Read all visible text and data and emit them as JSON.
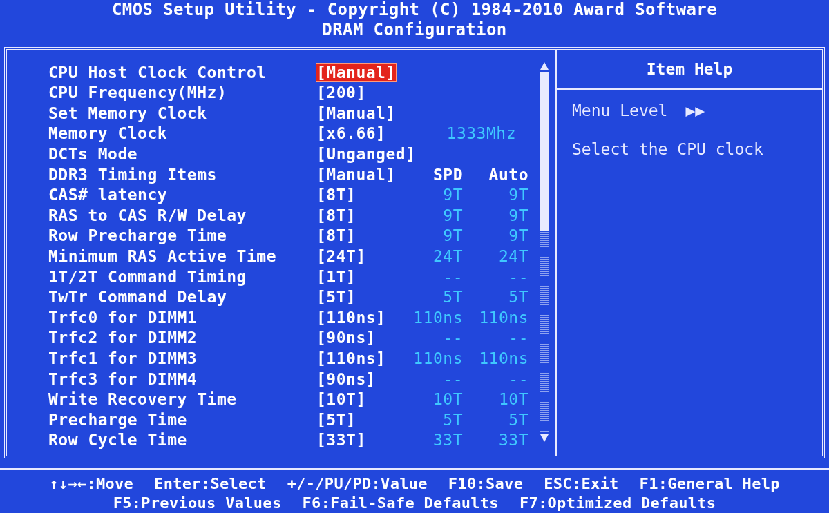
{
  "header": {
    "title": "CMOS Setup Utility - Copyright (C) 1984-2010 Award Software",
    "subtitle": "DRAM Configuration"
  },
  "settings": [
    {
      "kind": "plain",
      "label": "CPU Host Clock Control",
      "value": "[Manual]",
      "selected": true
    },
    {
      "kind": "plain",
      "label": "CPU Frequency(MHz)",
      "value": "[200]",
      "selected": false
    },
    {
      "kind": "plain",
      "label": "Set Memory Clock",
      "value": "[Manual]",
      "selected": false
    },
    {
      "kind": "note",
      "label": "Memory Clock",
      "value": "[x6.66]",
      "note": "1333Mhz",
      "selected": false
    },
    {
      "kind": "plain",
      "label": "DCTs Mode",
      "value": "[Unganged]",
      "selected": false
    },
    {
      "kind": "heading",
      "label": "DDR3 Timing Items",
      "value": "[Manual]",
      "spd": "SPD",
      "auto": "Auto",
      "selected": false
    },
    {
      "kind": "timing",
      "label": "CAS# latency",
      "value": "[8T]",
      "spd": "9T",
      "auto": "9T",
      "selected": false
    },
    {
      "kind": "timing",
      "label": "RAS to CAS R/W Delay",
      "value": "[8T]",
      "spd": "9T",
      "auto": "9T",
      "selected": false
    },
    {
      "kind": "timing",
      "label": "Row Precharge Time",
      "value": "[8T]",
      "spd": "9T",
      "auto": "9T",
      "selected": false
    },
    {
      "kind": "timing",
      "label": "Minimum RAS Active Time",
      "value": "[24T]",
      "spd": "24T",
      "auto": "24T",
      "selected": false
    },
    {
      "kind": "timing",
      "label": "1T/2T Command Timing",
      "value": "[1T]",
      "spd": "--",
      "auto": "--",
      "selected": false
    },
    {
      "kind": "timing",
      "label": "TwTr Command Delay",
      "value": "[5T]",
      "spd": "5T",
      "auto": "5T",
      "selected": false
    },
    {
      "kind": "timing",
      "label": "Trfc0 for DIMM1",
      "value": "[110ns]",
      "spd": "110ns",
      "auto": "110ns",
      "selected": false
    },
    {
      "kind": "timing",
      "label": "Trfc2 for DIMM2",
      "value": "[90ns]",
      "spd": "--",
      "auto": "--",
      "selected": false
    },
    {
      "kind": "timing",
      "label": "Trfc1 for DIMM3",
      "value": "[110ns]",
      "spd": "110ns",
      "auto": "110ns",
      "selected": false
    },
    {
      "kind": "timing",
      "label": "Trfc3 for DIMM4",
      "value": "[90ns]",
      "spd": "--",
      "auto": "--",
      "selected": false
    },
    {
      "kind": "timing",
      "label": "Write Recovery Time",
      "value": "[10T]",
      "spd": "10T",
      "auto": "10T",
      "selected": false
    },
    {
      "kind": "timing",
      "label": "Precharge Time",
      "value": "[5T]",
      "spd": "5T",
      "auto": "5T",
      "selected": false
    },
    {
      "kind": "timing",
      "label": "Row Cycle Time",
      "value": "[33T]",
      "spd": "33T",
      "auto": "33T",
      "selected": false
    }
  ],
  "item_help": {
    "title": "Item Help",
    "menu_level": "Menu Level",
    "menu_level_marker": "▶▶",
    "description": "Select the CPU clock"
  },
  "footer": [
    [
      "↑↓→←:Move",
      "Enter:Select",
      "+/-/PU/PD:Value",
      "F10:Save",
      "ESC:Exit",
      "F1:General Help"
    ],
    [
      "F5:Previous Values",
      "F6:Fail-Safe Defaults",
      "F7:Optimized Defaults"
    ]
  ]
}
